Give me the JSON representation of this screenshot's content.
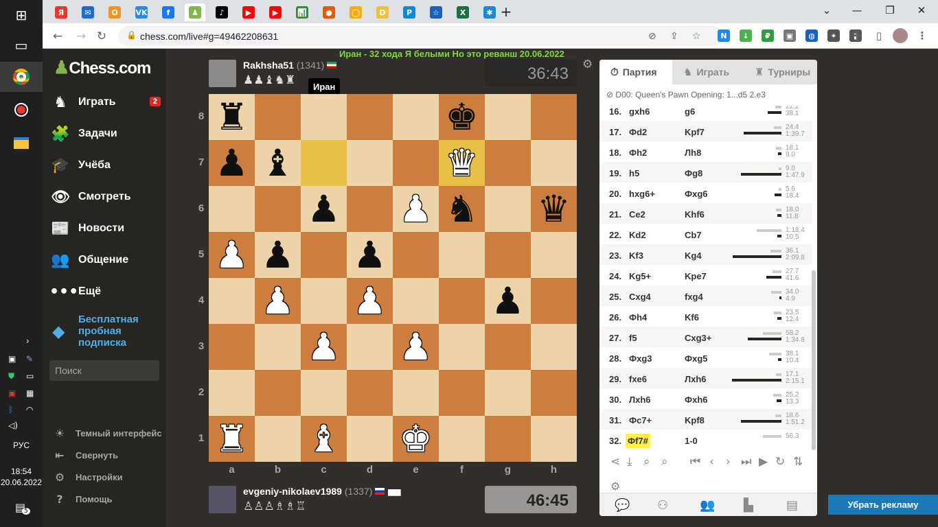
{
  "taskbar": {
    "time": "18:54",
    "date": "20.06.2022",
    "lang": "РУС",
    "notif_count": "5"
  },
  "browser": {
    "url": "chess.com/live#g=49462208631",
    "tab_favicons": [
      "Я",
      "✉",
      "О",
      "VK",
      "f",
      "♟",
      "♪",
      "▶",
      "▶",
      "📊",
      "●",
      "◯",
      "D",
      "P",
      "☆",
      "X",
      "✱"
    ],
    "tab_colors": [
      "#e33",
      "#1e6ad8",
      "#f7931e",
      "#2787f5",
      "#1877f2",
      "#81b64c",
      "#000",
      "#f00",
      "#f00",
      "#3a8a3a",
      "#e55a00",
      "#ffaa00",
      "#f0c040",
      "#0a8ad6",
      "#1b5fba",
      "#1d6f42",
      "#1a8ad0"
    ],
    "extensions": [
      "N",
      "↓",
      "₽",
      "▣",
      "◍",
      "✦",
      "▮"
    ],
    "extension_colors": [
      "#1e88e5",
      "#4caf50",
      "#2e9e3e",
      "#777",
      "#1565c0",
      "#555",
      "#555"
    ]
  },
  "sidebar": {
    "logo": "Chess.com",
    "items": [
      {
        "label": "Играть",
        "icon": "♞",
        "badge": "2"
      },
      {
        "label": "Задачи",
        "icon": "🧩"
      },
      {
        "label": "Учёба",
        "icon": "🎓"
      },
      {
        "label": "Смотреть",
        "icon": "👁"
      },
      {
        "label": "Новости",
        "icon": "📰"
      },
      {
        "label": "Общение",
        "icon": "👥"
      },
      {
        "label": "Ещё",
        "icon": "•••"
      }
    ],
    "trial": "Бесплатная пробная подписка",
    "search_placeholder": "Поиск",
    "bottom": [
      {
        "label": "Темный интерфейс",
        "icon": "☀"
      },
      {
        "label": "Свернуть",
        "icon": "⇤"
      },
      {
        "label": "Настройки",
        "icon": "⚙"
      },
      {
        "label": "Помощь",
        "icon": "?"
      }
    ]
  },
  "game": {
    "banner": "Иран - 32 хода Я белыми Но это реванш 20.06.2022",
    "top_player": {
      "name": "Rakhsha51",
      "rating": "(1341)",
      "captured": "♟♟♝♞♜",
      "clock": "36:43",
      "tooltip": "Иран"
    },
    "bottom_player": {
      "name": "evgeniy-nikolaev1989",
      "rating": "(1337)",
      "captured": "♙♙♙♗♗♖",
      "clock": "46:45"
    },
    "files": [
      "a",
      "b",
      "c",
      "d",
      "e",
      "f",
      "g",
      "h"
    ],
    "ranks": [
      "8",
      "7",
      "6",
      "5",
      "4",
      "3",
      "2",
      "1"
    ],
    "position": [
      "r....k..",
      "pb...Q..",
      "..p.Pn.q",
      "Pp.p....",
      ".P.P..p.",
      "..P.P...",
      "........",
      "R.B.K..."
    ],
    "highlight": [
      "c7",
      "f7"
    ]
  },
  "panel": {
    "tabs": [
      {
        "label": "Партия",
        "icon": "⏱"
      },
      {
        "label": "Играть",
        "icon": "♞"
      },
      {
        "label": "Турниры",
        "icon": "🏆"
      }
    ],
    "opening": "D00: Queen's Pawn Opening: 1...d5 2.e3",
    "moves": [
      {
        "n": "16.",
        "w": "gxh6",
        "b": "g6",
        "wt": "22.2",
        "bt": "38.1",
        "wf": 0.1,
        "bf": 0.2
      },
      {
        "n": "17.",
        "w": "Фd2",
        "b": "Kpf7",
        "wt": "24.4",
        "bt": "1:39.7",
        "wf": 0.12,
        "bf": 0.56
      },
      {
        "n": "18.",
        "w": "Фh2",
        "b": "Лh8",
        "wt": "18.1",
        "bt": "9.0",
        "wf": 0.09,
        "bf": 0.05
      },
      {
        "n": "19.",
        "w": "h5",
        "b": "Фg8",
        "wt": "9.0",
        "bt": "1:47.9",
        "wf": 0.05,
        "bf": 0.6
      },
      {
        "n": "20.",
        "w": "hxg6+",
        "b": "Фxg6",
        "wt": "5.6",
        "bt": "18.4",
        "wf": 0.03,
        "bf": 0.1
      },
      {
        "n": "21.",
        "w": "Ce2",
        "b": "Khf6",
        "wt": "18.0",
        "bt": "11.8",
        "wf": 0.09,
        "bf": 0.06
      },
      {
        "n": "22.",
        "w": "Kd2",
        "b": "Cb7",
        "wt": "1:18.4",
        "bt": "10.5",
        "wf": 0.4,
        "bf": 0.06
      },
      {
        "n": "23.",
        "w": "Kf3",
        "b": "Kg4",
        "wt": "36.1",
        "bt": "2:09.8",
        "wf": 0.18,
        "bf": 0.72
      },
      {
        "n": "24.",
        "w": "Kg5+",
        "b": "Kpe7",
        "wt": "27.7",
        "bt": "41.6",
        "wf": 0.14,
        "bf": 0.22
      },
      {
        "n": "25.",
        "w": "Cxg4",
        "b": "fxg4",
        "wt": "34.0",
        "bt": "4.9",
        "wf": 0.17,
        "bf": 0.02
      },
      {
        "n": "26.",
        "w": "Фh4",
        "b": "Kf6",
        "wt": "23.5",
        "bt": "12.4",
        "wf": 0.12,
        "bf": 0.06
      },
      {
        "n": "27.",
        "w": "f5",
        "b": "Cxg3+",
        "wt": "58.2",
        "bt": "1:34.8",
        "wf": 0.3,
        "bf": 0.5
      },
      {
        "n": "28.",
        "w": "Фxg3",
        "b": "Фxg5",
        "wt": "38.1",
        "bt": "10.4",
        "wf": 0.2,
        "bf": 0.05
      },
      {
        "n": "29.",
        "w": "fxe6",
        "b": "Лxh6",
        "wt": "17.1",
        "bt": "2:15.1",
        "wf": 0.09,
        "bf": 0.73
      },
      {
        "n": "30.",
        "w": "Лxh6",
        "b": "Фxh6",
        "wt": "25.2",
        "bt": "13.3",
        "wf": 0.13,
        "bf": 0.07
      },
      {
        "n": "31.",
        "w": "Фc7+",
        "b": "Kpf8",
        "wt": "18.6",
        "bt": "1:51.2",
        "wf": 0.1,
        "bf": 0.6
      },
      {
        "n": "32.",
        "w": "Фf7#",
        "b": "1-0",
        "wt": "56.3",
        "bt": "",
        "wf": 0.3,
        "bf": 0
      }
    ]
  },
  "ad_button": "Убрать рекламу"
}
